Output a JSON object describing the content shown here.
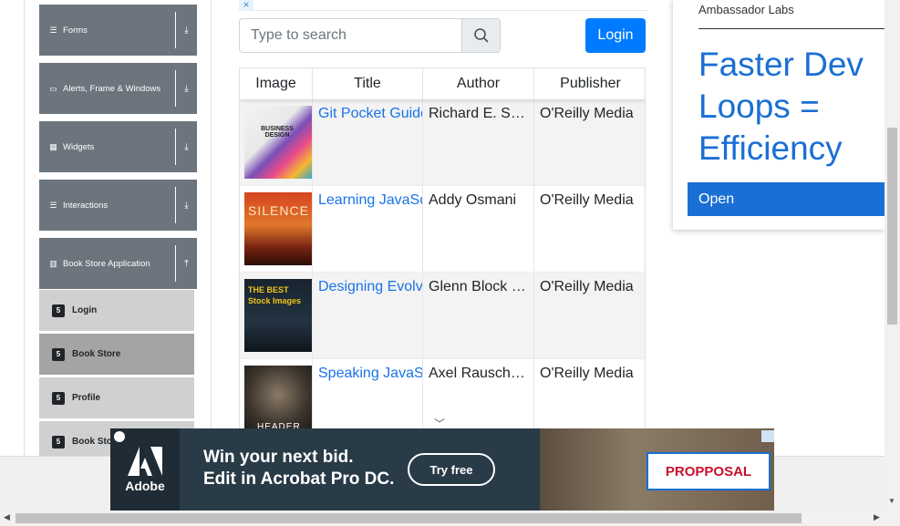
{
  "sidebar": {
    "groups": [
      {
        "label": "Forms",
        "icon": "list-icon"
      },
      {
        "label": "Alerts, Frame & Windows",
        "icon": "window-icon"
      },
      {
        "label": "Widgets",
        "icon": "grid-icon"
      },
      {
        "label": "Interactions",
        "icon": "list-icon"
      },
      {
        "label": "Book Store Application",
        "icon": "library-icon"
      }
    ],
    "items": [
      {
        "label": "Login"
      },
      {
        "label": "Book Store"
      },
      {
        "label": "Profile"
      },
      {
        "label": "Book Store API"
      }
    ]
  },
  "search": {
    "placeholder": "Type to search"
  },
  "login_button": "Login",
  "table": {
    "headers": [
      "Image",
      "Title",
      "Author",
      "Publisher"
    ],
    "rows": [
      {
        "title": "Git Pocket Guide",
        "author": "Richard E. Silverman",
        "publisher": "O'Reilly Media",
        "cover": "BUSINESS DESIGN"
      },
      {
        "title": "Learning JavaScript Design Patterns",
        "author": "Addy Osmani",
        "publisher": "O'Reilly Media",
        "cover": "SILENCE"
      },
      {
        "title": "Designing Evolvable Web APIs with ASP.NET",
        "author": "Glenn Block et al.",
        "publisher": "O'Reilly Media",
        "cover": "THE BEST Stock Images"
      },
      {
        "title": "Speaking JavaScript",
        "author": "Axel Rauschmayer",
        "publisher": "O'Reilly Media",
        "cover": "HEADER"
      }
    ]
  },
  "side_ad": {
    "brand": "Ambassador Labs",
    "headline": "Faster Dev Loops = Efficiency",
    "cta": "Open"
  },
  "bottom_ad": {
    "brand": "Adobe",
    "line1": "Win your next bid.",
    "line2": "Edit in Acrobat Pro DC.",
    "cta": "Try free",
    "proposal": "PROPPOSAL"
  },
  "colors": {
    "accent": "#007bff",
    "sidebar_group": "#6c757d",
    "link": "#1a73e8"
  }
}
